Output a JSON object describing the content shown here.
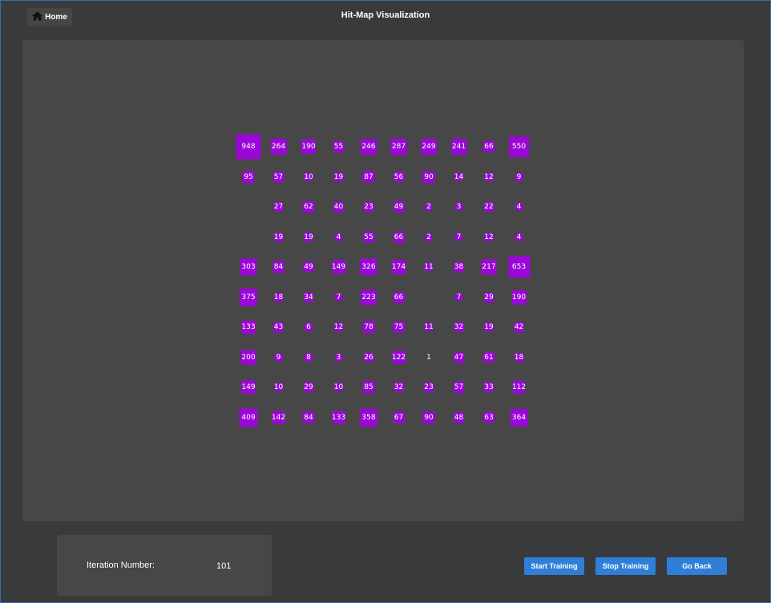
{
  "header": {
    "home_label": "Home",
    "title": "Hit-Map Visualization"
  },
  "hitmap": {
    "cell_color": "#9b07d6",
    "max_value": 948,
    "rows": [
      [
        "948",
        "264",
        "190",
        "55",
        "246",
        "287",
        "249",
        "241",
        "66",
        "550"
      ],
      [
        "95",
        "57",
        "10",
        "19",
        "87",
        "56",
        "90",
        "14",
        "12",
        "9"
      ],
      [
        "",
        "27",
        "62",
        "40",
        "23",
        "49",
        "2",
        "3",
        "22",
        "4"
      ],
      [
        "",
        "19",
        "19",
        "4",
        "55",
        "66",
        "2",
        "7",
        "12",
        "4"
      ],
      [
        "303",
        "84",
        "49",
        "149",
        "326",
        "174",
        "11",
        "38",
        "217",
        "653"
      ],
      [
        "375",
        "18",
        "34",
        "7",
        "223",
        "66",
        "",
        "7",
        "29",
        "190"
      ],
      [
        "133",
        "43",
        "6",
        "12",
        "78",
        "75",
        "11",
        "32",
        "19",
        "42"
      ],
      [
        "200",
        "9",
        "8",
        "3",
        "26",
        "122",
        "1",
        "47",
        "61",
        "18"
      ],
      [
        "149",
        "10",
        "29",
        "10",
        "85",
        "32",
        "23",
        "57",
        "33",
        "112"
      ],
      [
        "409",
        "142",
        "84",
        "133",
        "358",
        "67",
        "90",
        "48",
        "63",
        "364"
      ]
    ]
  },
  "footer": {
    "iteration_label": "Iteration Number:",
    "iteration_value": "101",
    "start_label": "Start Training",
    "stop_label": "Stop Training",
    "back_label": "Go Back"
  }
}
